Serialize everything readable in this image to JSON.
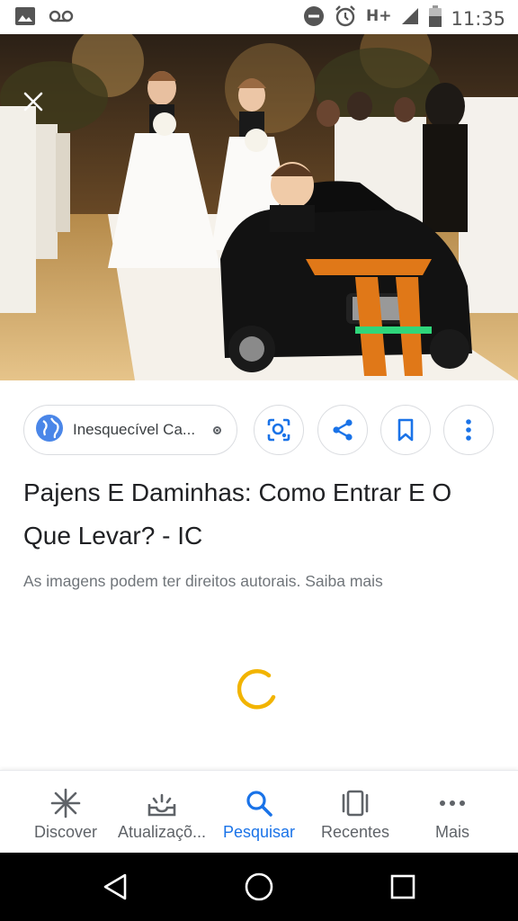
{
  "status_bar": {
    "time": "11:35",
    "network": "H+",
    "icons": [
      "image-icon",
      "voicemail-icon",
      "do-not-disturb-icon",
      "alarm-icon",
      "signal-icon",
      "battery-icon"
    ]
  },
  "image_viewer": {
    "close_icon": "close-icon",
    "source_chip": {
      "icon": "globe-icon",
      "label": "Inesquecível Ca..."
    },
    "actions": [
      "lens-icon",
      "share-icon",
      "bookmark-icon",
      "more-vert-icon"
    ],
    "title": "Pajens E Daminhas: Como Entrar E O Que Levar? - IC",
    "copyright_notice": "As imagens podem ter direitos autorais. Saiba mais",
    "loading": true
  },
  "bottom_nav": {
    "items": [
      {
        "label": "Discover",
        "icon": "asterisk-icon",
        "active": false
      },
      {
        "label": "Atualizaçõ...",
        "icon": "updates-icon",
        "active": false
      },
      {
        "label": "Pesquisar",
        "icon": "search-icon",
        "active": true
      },
      {
        "label": "Recentes",
        "icon": "recents-icon",
        "active": false
      },
      {
        "label": "Mais",
        "icon": "more-horiz-icon",
        "active": false
      }
    ]
  },
  "system_nav": [
    "back-icon",
    "home-icon",
    "overview-icon"
  ],
  "colors": {
    "accent": "#1a73e8",
    "spinner": "#f2b400",
    "text_primary": "#202124",
    "text_secondary": "#70757a",
    "border": "#dadce0"
  }
}
